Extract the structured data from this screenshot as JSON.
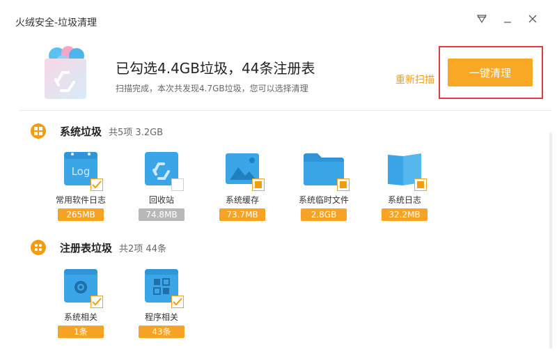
{
  "window": {
    "title": "火绒安全-垃圾清理"
  },
  "header": {
    "headline": "已勾选4.4GB垃圾，44条注册表",
    "subline": "扫描完成，本次共发现4.7GB垃圾，您可以选择清理",
    "rescan_label": "重新扫描",
    "clean_label": "一键清理"
  },
  "colors": {
    "accent": "#f9a825",
    "link": "#f39c12",
    "highlight": "#e03c3c",
    "icon_blue": "#3aa6e8"
  },
  "sections": [
    {
      "title": "系统垃圾",
      "meta": "共5项 3.2GB",
      "items": [
        {
          "label": "常用软件日志",
          "badge": "265MB",
          "icon": "log-file-icon",
          "state": "checked"
        },
        {
          "label": "回收站",
          "badge": "74.8MB",
          "icon": "recycle-bin-icon",
          "state": "unchecked"
        },
        {
          "label": "系统缓存",
          "badge": "73.7MB",
          "icon": "image-cache-icon",
          "state": "partial"
        },
        {
          "label": "系统临时文件",
          "badge": "2.8GB",
          "icon": "folder-icon",
          "state": "partial"
        },
        {
          "label": "系统日志",
          "badge": "32.2MB",
          "icon": "book-icon",
          "state": "partial"
        }
      ]
    },
    {
      "title": "注册表垃圾",
      "meta": "共2项 44条",
      "items": [
        {
          "label": "系统相关",
          "badge": "1条",
          "icon": "gear-file-icon",
          "state": "checked"
        },
        {
          "label": "程序相关",
          "badge": "43条",
          "icon": "grid-file-icon",
          "state": "checked"
        }
      ]
    }
  ]
}
